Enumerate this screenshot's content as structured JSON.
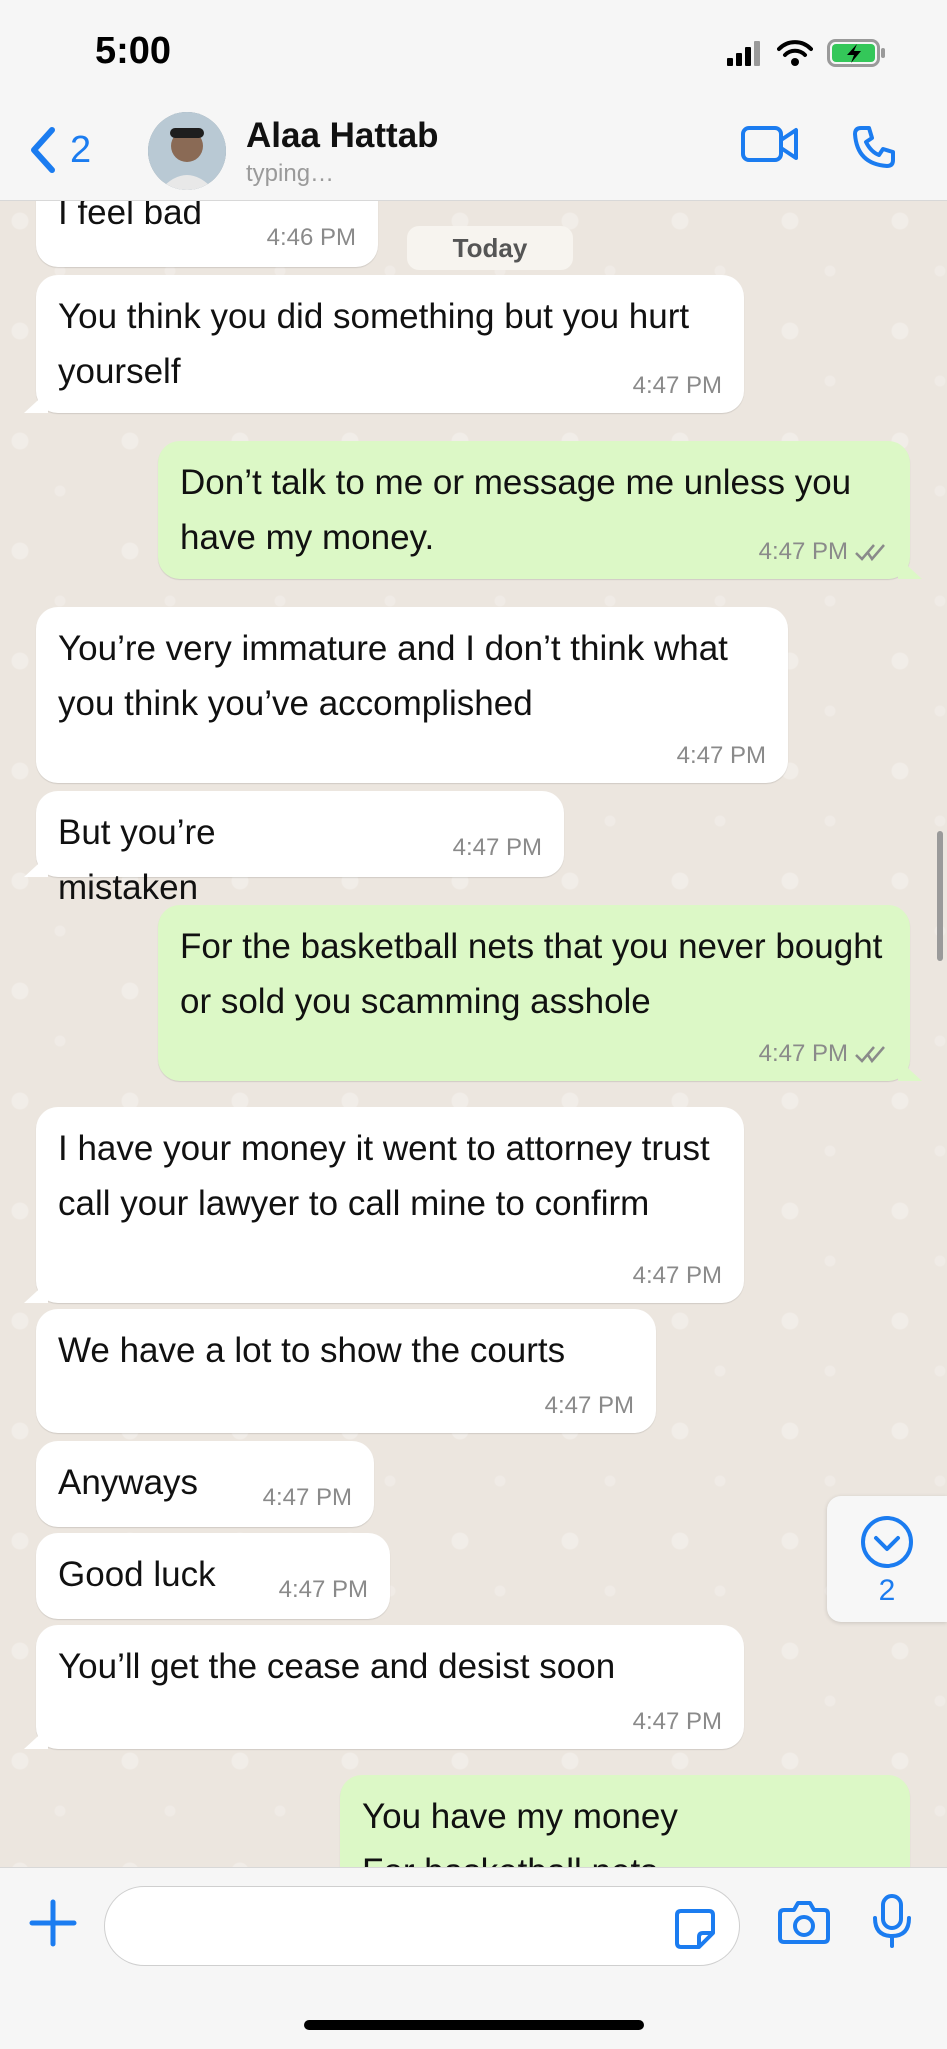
{
  "status_bar": {
    "time": "5:00"
  },
  "header": {
    "back_count": "2",
    "contact_name": "Alaa Hattab",
    "contact_status": "typing…"
  },
  "chat": {
    "date_separator": "Today",
    "messages": [
      {
        "dir": "in",
        "text": "I feel bad",
        "time": "4:46 PM"
      },
      {
        "dir": "in",
        "text": "You think you did something but you hurt yourself",
        "time": "4:47 PM"
      },
      {
        "dir": "out",
        "text": "Don’t talk to me or message me unless you have my money.",
        "time": "4:47 PM"
      },
      {
        "dir": "in",
        "text": "You’re very immature and I don’t think what you think you’ve accomplished",
        "time": "4:47 PM"
      },
      {
        "dir": "in",
        "text": "But you’re mistaken",
        "time": "4:47 PM"
      },
      {
        "dir": "out",
        "text": "For the basketball nets that you never bought or sold you scamming asshole",
        "time": "4:47 PM"
      },
      {
        "dir": "in",
        "text": "I have your money it went to attorney trust call your lawyer to call mine to confirm",
        "time": "4:47 PM"
      },
      {
        "dir": "in",
        "text": "We have a lot to show the courts",
        "time": "4:47 PM"
      },
      {
        "dir": "in",
        "text": "Anyways",
        "time": "4:47 PM"
      },
      {
        "dir": "in",
        "text": "Good luck",
        "time": "4:47 PM"
      },
      {
        "dir": "in",
        "text": "You’ll get the cease and desist soon",
        "time": "4:47 PM"
      },
      {
        "dir": "out",
        "text": "You have my money\nFor basketball nets",
        "time": ""
      }
    ],
    "unread_badge": "2"
  },
  "icons": {
    "back": "chevron-left-icon",
    "video": "video-camera-icon",
    "phone": "phone-icon",
    "add": "plus-icon",
    "sticker": "sticker-icon",
    "camera": "camera-icon",
    "mic": "microphone-icon",
    "read": "double-check-icon",
    "scroll_down": "chevron-down-circle-icon"
  },
  "colors": {
    "accent": "#1b7cf0",
    "outgoing_bubble": "#dcf8c6",
    "incoming_bubble": "#ffffff",
    "chat_background": "#ece6df",
    "battery": "#34c759"
  }
}
